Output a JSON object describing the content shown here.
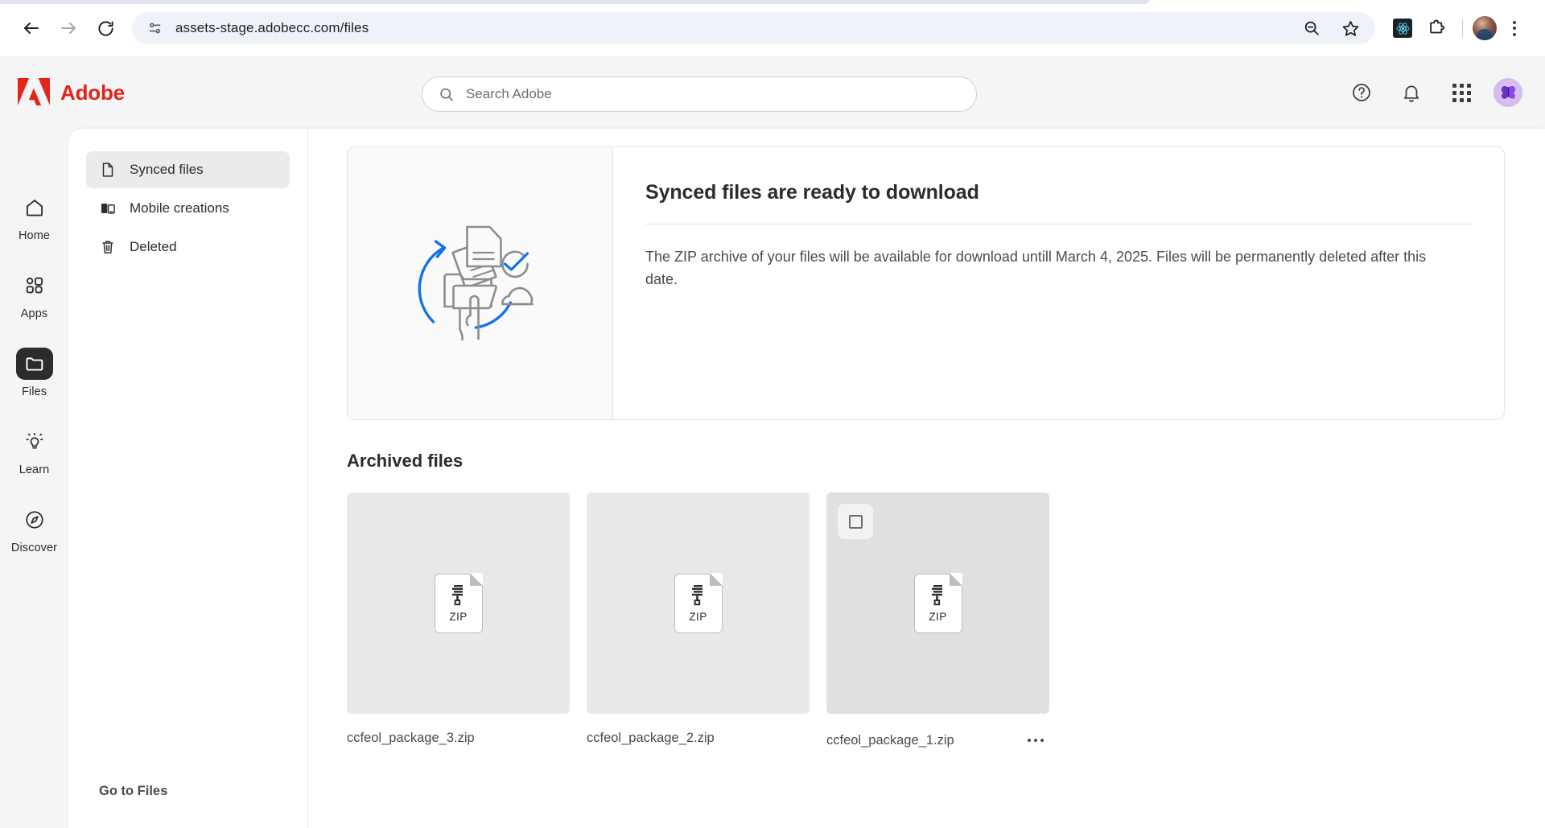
{
  "browser": {
    "back_label": "Back",
    "forward_label": "Forward",
    "reload_label": "Reload",
    "site_info_label": "View site information",
    "url": "assets-stage.adobecc.com/files",
    "zoom_out_label": "Zoom out",
    "bookmark_label": "Bookmark this tab",
    "react_extension_label": "React Developer Tools",
    "extensions_label": "Extensions",
    "profile_label": "Profile",
    "menu_label": "Customize and control Google Chrome"
  },
  "header": {
    "brand": "Adobe",
    "search": {
      "placeholder": "Search Adobe",
      "value": ""
    },
    "actions": [
      {
        "name": "help",
        "label": "Help"
      },
      {
        "name": "notifications",
        "label": "Notifications"
      },
      {
        "name": "app-switcher",
        "label": "App switcher"
      },
      {
        "name": "account",
        "label": "Account"
      }
    ]
  },
  "rail": {
    "items": [
      {
        "label": "Home",
        "icon": "home-icon",
        "active": false
      },
      {
        "label": "Apps",
        "icon": "apps-icon",
        "active": false
      },
      {
        "label": "Files",
        "icon": "folder-icon",
        "active": true
      },
      {
        "label": "Learn",
        "icon": "lightbulb-icon",
        "active": false
      },
      {
        "label": "Discover",
        "icon": "compass-icon",
        "active": false
      }
    ]
  },
  "subnav": {
    "items": [
      {
        "label": "Synced files",
        "icon": "document-icon",
        "active": true
      },
      {
        "label": "Mobile creations",
        "icon": "mobile-icon",
        "active": false
      },
      {
        "label": "Deleted",
        "icon": "trash-icon",
        "active": false
      }
    ],
    "footer_link": "Go to Files"
  },
  "banner": {
    "illustration_name": "sync-complete-illustration",
    "title": "Synced files are ready to download",
    "body": "The ZIP archive of your files will be available for download untill March 4, 2025. Files will be permanently deleted after this date."
  },
  "archived": {
    "section_title": "Archived files",
    "files": [
      {
        "name": "ccfeol_package_3.zip",
        "type": "ZIP",
        "hovered": false,
        "selected": false,
        "show_menu": false
      },
      {
        "name": "ccfeol_package_2.zip",
        "type": "ZIP",
        "hovered": false,
        "selected": false,
        "show_menu": false
      },
      {
        "name": "ccfeol_package_1.zip",
        "type": "ZIP",
        "hovered": true,
        "selected": false,
        "show_menu": true
      }
    ]
  },
  "colors": {
    "adobe_red": "#e1251b",
    "accent_blue": "#1473e6",
    "rail_active": "#2c2c2c",
    "thumb_bg": "#e8e8e8",
    "omnibox_bg": "#eff2f9"
  }
}
